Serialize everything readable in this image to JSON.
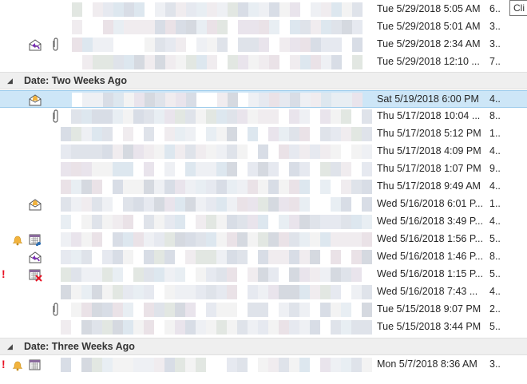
{
  "tooltip": {
    "text": "Cli"
  },
  "groups": [
    {
      "label": "Date: Two Weeks Ago"
    },
    {
      "label": "Date: Three Weeks Ago"
    }
  ],
  "rows": [
    {
      "date": "Tue 5/29/2018 5:05 AM",
      "more": "6..",
      "icons": []
    },
    {
      "date": "Tue 5/29/2018 5:01 AM",
      "more": "3..",
      "icons": []
    },
    {
      "date": "Tue 5/29/2018 2:34 AM",
      "more": "3..",
      "icons": [
        "replied-icon",
        "attachment-icon"
      ]
    },
    {
      "date": "Tue 5/29/2018 12:10 ...",
      "more": "7..",
      "icons": []
    },
    {
      "date": "Sat 5/19/2018 6:00 PM",
      "more": "4..",
      "icons": [
        "meeting-message-icon"
      ],
      "selected": true
    },
    {
      "date": "Thu 5/17/2018 10:04 ...",
      "more": "8..",
      "icons": [
        "attachment-icon"
      ]
    },
    {
      "date": "Thu 5/17/2018 5:12 PM",
      "more": "1..",
      "icons": []
    },
    {
      "date": "Thu 5/17/2018 4:09 PM",
      "more": "4..",
      "icons": []
    },
    {
      "date": "Thu 5/17/2018 1:07 PM",
      "more": "9..",
      "icons": []
    },
    {
      "date": "Thu 5/17/2018 9:49 AM",
      "more": "4..",
      "icons": []
    },
    {
      "date": "Wed 5/16/2018 6:01 P...",
      "more": "1..",
      "icons": [
        "meeting-message-icon"
      ]
    },
    {
      "date": "Wed 5/16/2018 3:49 P...",
      "more": "4..",
      "icons": []
    },
    {
      "date": "Wed 5/16/2018 1:56 P...",
      "more": "5..",
      "icons": [
        "reminder-bell-icon",
        "meeting-request-icon"
      ]
    },
    {
      "date": "Wed 5/16/2018 1:46 P...",
      "more": "8..",
      "icons": [
        "replied-icon"
      ]
    },
    {
      "date": "Wed 5/16/2018 1:15 P...",
      "more": "5..",
      "icons": [
        "importance-high-icon",
        "meeting-canceled-icon"
      ]
    },
    {
      "date": "Wed 5/16/2018 7:43 ...",
      "more": "4..",
      "icons": []
    },
    {
      "date": "Tue 5/15/2018 9:07 PM",
      "more": "2..",
      "icons": [
        "attachment-icon"
      ]
    },
    {
      "date": "Tue 5/15/2018 3:44 PM",
      "more": "5..",
      "icons": []
    },
    {
      "date": "Mon 5/7/2018 8:36 AM",
      "more": "3..",
      "icons": [
        "importance-high-icon",
        "reminder-bell-icon",
        "calendar-icon"
      ]
    }
  ]
}
